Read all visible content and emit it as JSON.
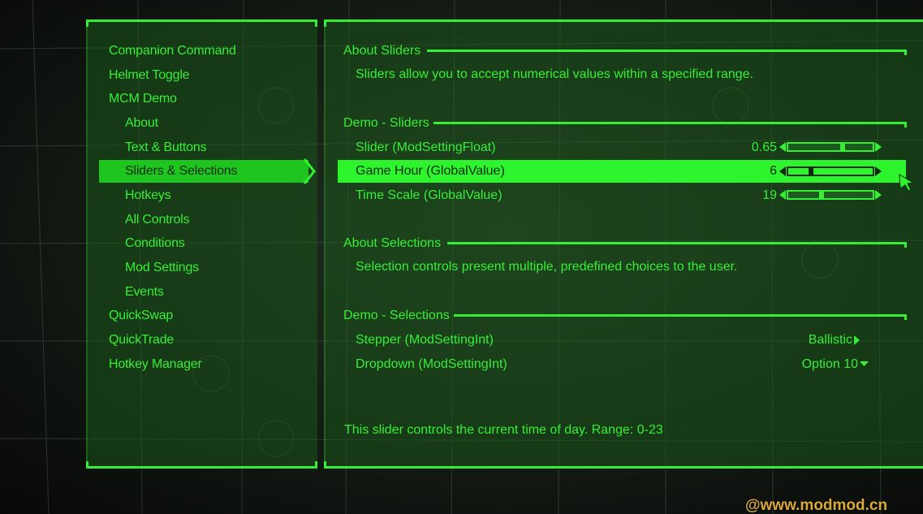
{
  "sidebar": {
    "items": [
      {
        "label": "Companion Command",
        "level": "top",
        "selected": false
      },
      {
        "label": "Helmet Toggle",
        "level": "top",
        "selected": false
      },
      {
        "label": "MCM Demo",
        "level": "top",
        "selected": false
      },
      {
        "label": "About",
        "level": "sub",
        "selected": false
      },
      {
        "label": "Text & Buttons",
        "level": "sub",
        "selected": false
      },
      {
        "label": "Sliders & Selections",
        "level": "sub",
        "selected": true
      },
      {
        "label": "Hotkeys",
        "level": "sub",
        "selected": false
      },
      {
        "label": "All Controls",
        "level": "sub",
        "selected": false
      },
      {
        "label": "Conditions",
        "level": "sub",
        "selected": false
      },
      {
        "label": "Mod Settings",
        "level": "sub",
        "selected": false
      },
      {
        "label": "Events",
        "level": "sub",
        "selected": false
      },
      {
        "label": "QuickSwap",
        "level": "top",
        "selected": false
      },
      {
        "label": "QuickTrade",
        "level": "top",
        "selected": false
      },
      {
        "label": "Hotkey Manager",
        "level": "top",
        "selected": false
      }
    ]
  },
  "main": {
    "about_sliders": {
      "title": "About Sliders",
      "text": "Sliders allow you to accept numerical values within a specified range."
    },
    "demo_sliders": {
      "title": "Demo - Sliders",
      "rows": [
        {
          "label": "Slider (ModSettingFloat)",
          "value": "0.65",
          "fill": 0.65,
          "selected": false
        },
        {
          "label": "Game Hour (GlobalValue)",
          "value": "6",
          "fill": 0.26,
          "selected": true
        },
        {
          "label": "Time Scale (GlobalValue)",
          "value": "19",
          "fill": 0.39,
          "selected": false
        }
      ]
    },
    "about_selections": {
      "title": "About Selections",
      "text": "Selection controls present multiple, predefined choices to the user."
    },
    "demo_selections": {
      "title": "Demo - Selections",
      "stepper": {
        "label": "Stepper (ModSettingInt)",
        "value": "Ballistic"
      },
      "dropdown": {
        "label": "Dropdown (ModSettingInt)",
        "value": "Option 10"
      }
    },
    "help_text": "This slider controls the current time of day. Range: 0-23"
  },
  "watermark": "@www.modmod.cn",
  "colors": {
    "pipboy_green": "#37ee37",
    "highlight_green": "#2ef42e",
    "panel_green": "#1a561a",
    "dark_text": "#0a2a0a",
    "watermark_gold": "#d9a93a"
  },
  "icons": {
    "nav_selected": "chevron-right-icon",
    "stepper": "triangle-right-icon",
    "dropdown": "triangle-down-icon",
    "slider_ends": "slider-arrow-icon",
    "cursor": "mouse-cursor-icon"
  }
}
